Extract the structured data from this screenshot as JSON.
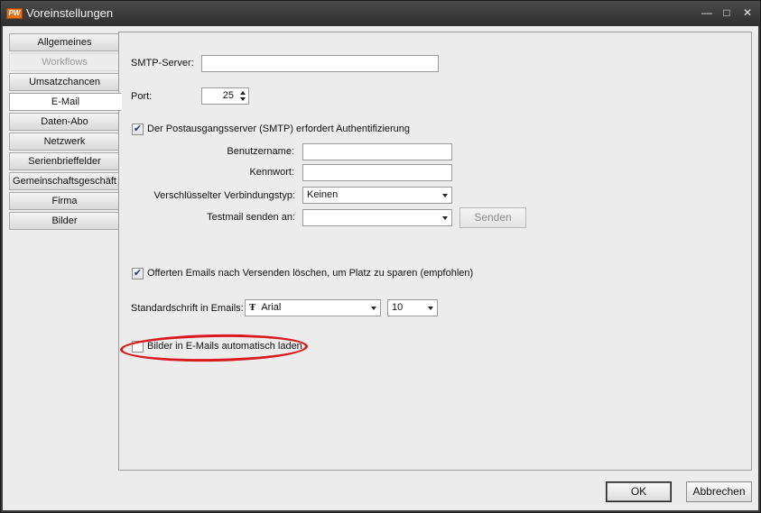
{
  "window": {
    "title": "Voreinstellungen",
    "logo_text": "PW"
  },
  "titlebar_buttons": {
    "minimize": "—",
    "maximize": "□",
    "close": "✕"
  },
  "nav": {
    "items": [
      {
        "label": "Allgemeines",
        "state": "normal"
      },
      {
        "label": "Workflows",
        "state": "disabled"
      },
      {
        "label": "Umsatzchancen",
        "state": "normal"
      },
      {
        "label": "E-Mail",
        "state": "active"
      },
      {
        "label": "Daten-Abo",
        "state": "normal"
      },
      {
        "label": "Netzwerk",
        "state": "normal"
      },
      {
        "label": "Serienbrieffelder",
        "state": "normal"
      },
      {
        "label": "Gemeinschaftsgeschäft",
        "state": "normal"
      },
      {
        "label": "Firma",
        "state": "normal"
      },
      {
        "label": "Bilder",
        "state": "normal"
      }
    ]
  },
  "email": {
    "smtp_label": "SMTP-Server:",
    "smtp_value": "",
    "port_label": "Port:",
    "port_value": "25",
    "auth_checkbox_label": "Der Postausgangsserver (SMTP) erfordert Authentifizierung",
    "auth_checked": true,
    "username_label": "Benutzername:",
    "username_value": "",
    "password_label": "Kennwort:",
    "password_value": "",
    "encryption_label": "Verschlüsselter Verbindungstyp:",
    "encryption_value": "Keinen",
    "testmail_label": "Testmail senden an:",
    "testmail_value": "",
    "send_button": "Senden",
    "delete_checkbox_label": "Offerten Emails nach Versenden löschen, um Platz zu sparen (empfohlen)",
    "delete_checked": true,
    "font_label": "Standardschrift in Emails:",
    "font_value": "Arial",
    "font_size_value": "10",
    "images_checkbox_label": "Bilder in E-Mails automatisch laden",
    "images_checked": false
  },
  "footer": {
    "ok_label": "OK",
    "cancel_label": "Abbrechen"
  },
  "colors": {
    "highlight": "#d8191d",
    "title_bar": "#3a3a3a"
  }
}
